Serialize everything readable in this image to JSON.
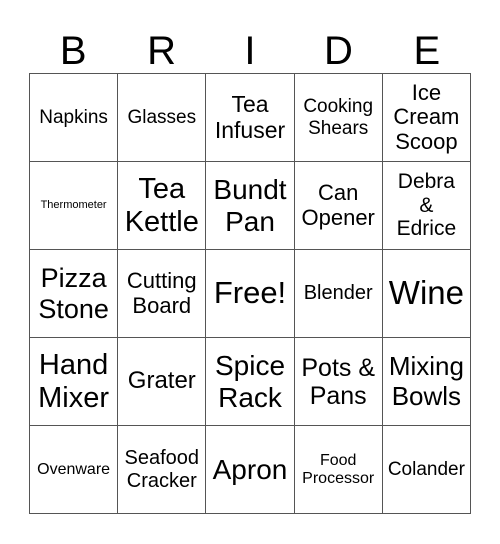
{
  "header": {
    "letters": [
      "B",
      "R",
      "I",
      "D",
      "E"
    ]
  },
  "board": {
    "cells": [
      "Napkins",
      "Glasses",
      "Tea\nInfuser",
      "Cooking\nShears",
      "Ice\nCream\nScoop",
      "Thermometer",
      "Tea\nKettle",
      "Bundt\nPan",
      "Can\nOpener",
      "Debra\n&\nEdrice",
      "Pizza\nStone",
      "Cutting\nBoard",
      "Free!",
      "Blender",
      "Wine",
      "Hand\nMixer",
      "Grater",
      "Spice\nRack",
      "Pots &\nPans",
      "Mixing\nBowls",
      "Ovenware",
      "Seafood\nCracker",
      "Apron",
      "Food\nProcessor",
      "Colander"
    ]
  }
}
